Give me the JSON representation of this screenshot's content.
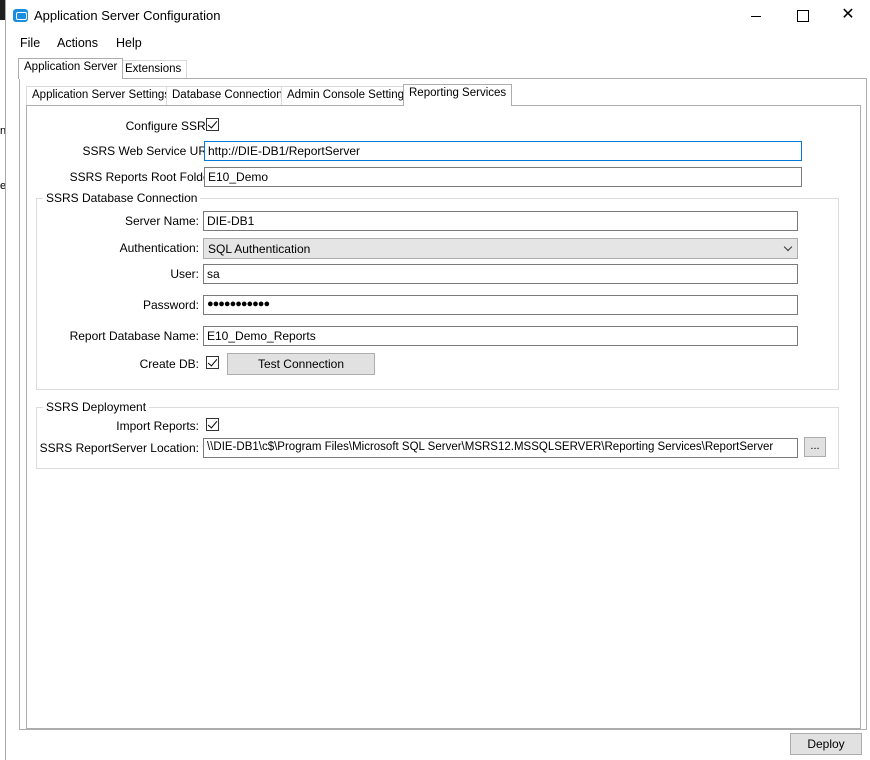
{
  "background": {
    "chars": [
      "n",
      "e"
    ]
  },
  "window": {
    "title": "Application Server Configuration"
  },
  "menu": {
    "file": "File",
    "actions": "Actions",
    "help": "Help"
  },
  "outer_tabs": {
    "application_server": "Application Server",
    "extensions": "Extensions"
  },
  "inner_tabs": {
    "app_server_settings": "Application Server Settings",
    "database_connection": "Database Connection",
    "admin_console_settings": "Admin Console Settings",
    "reporting_services": "Reporting Services"
  },
  "ssrs": {
    "configure_label": "Configure SSRS:",
    "configure_checked": true,
    "url_label": "SSRS Web Service URL:",
    "url_value": "http://DIE-DB1/ReportServer",
    "root_label": "SSRS Reports Root Folder:",
    "root_value": "E10_Demo"
  },
  "db_connection": {
    "group_title": "SSRS Database Connection",
    "server_label": "Server Name:",
    "server_value": "DIE-DB1",
    "auth_label": "Authentication:",
    "auth_value": "SQL Authentication",
    "user_label": "User:",
    "user_value": "sa",
    "password_label": "Password:",
    "password_value": "●●●●●●●●●●●",
    "report_db_label": "Report Database Name:",
    "report_db_value": "E10_Demo_Reports",
    "create_db_label": "Create DB:",
    "create_db_checked": true,
    "test_button": "Test Connection"
  },
  "deployment": {
    "group_title": "SSRS Deployment",
    "import_label": "Import Reports:",
    "import_checked": true,
    "location_label": "SSRS ReportServer Location:",
    "location_value": "\\\\DIE-DB1\\c$\\Program Files\\Microsoft SQL Server\\MSRS12.MSSQLSERVER\\Reporting Services\\ReportServer",
    "browse_button": "..."
  },
  "footer": {
    "deploy_button": "Deploy"
  }
}
